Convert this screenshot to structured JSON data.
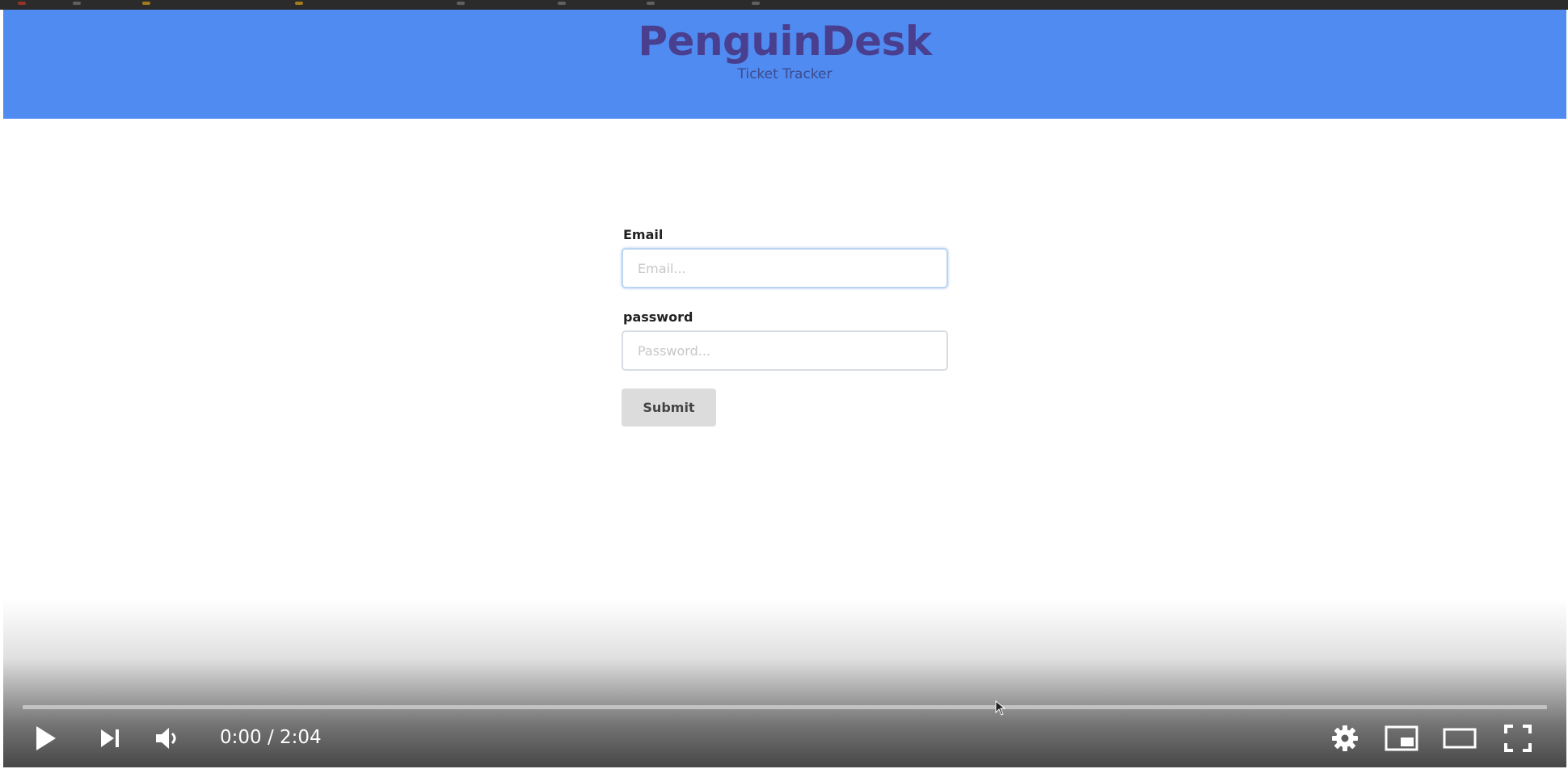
{
  "header": {
    "brand": "PenguinDesk",
    "tagline": "Ticket Tracker",
    "background_color": "#4f8bf0",
    "brand_color": "#4a3f8f"
  },
  "form": {
    "email_label": "Email",
    "email_placeholder": "Email...",
    "email_value": "",
    "password_label": "password",
    "password_placeholder": "Password...",
    "password_value": "",
    "submit_label": "Submit"
  },
  "player": {
    "time_current": "0:00",
    "time_total": "2:04",
    "time_text": "0:00 / 2:04",
    "progress_fraction": 0,
    "controls": [
      "play-icon",
      "next-icon",
      "volume-icon",
      "settings-gear-icon",
      "miniplayer-icon",
      "theater-mode-icon",
      "fullscreen-icon"
    ]
  }
}
